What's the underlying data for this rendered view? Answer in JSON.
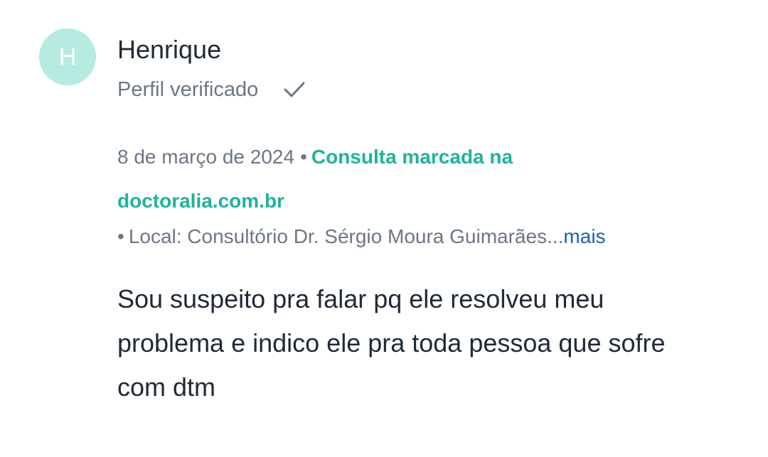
{
  "colors": {
    "avatar_bg": "#b5ebe0",
    "accent": "#1fb39b",
    "link": "#1a62b8",
    "check": "#6b7785"
  },
  "review": {
    "avatar_initial": "H",
    "author_name": "Henrique",
    "verified_label": "Perfil verificado",
    "verified_icon": "check-icon",
    "date": "8 de março de 2024",
    "separator": "•",
    "booked_via": "Consulta marcada na doctoralia.com.br",
    "location_bullet": "•",
    "location": "Local: Consultório Dr. Sérgio Moura Guimarães...",
    "more_label": "mais",
    "text": "Sou suspeito pra falar pq ele resolveu meu problema e indico ele pra toda pessoa que sofre com dtm"
  }
}
